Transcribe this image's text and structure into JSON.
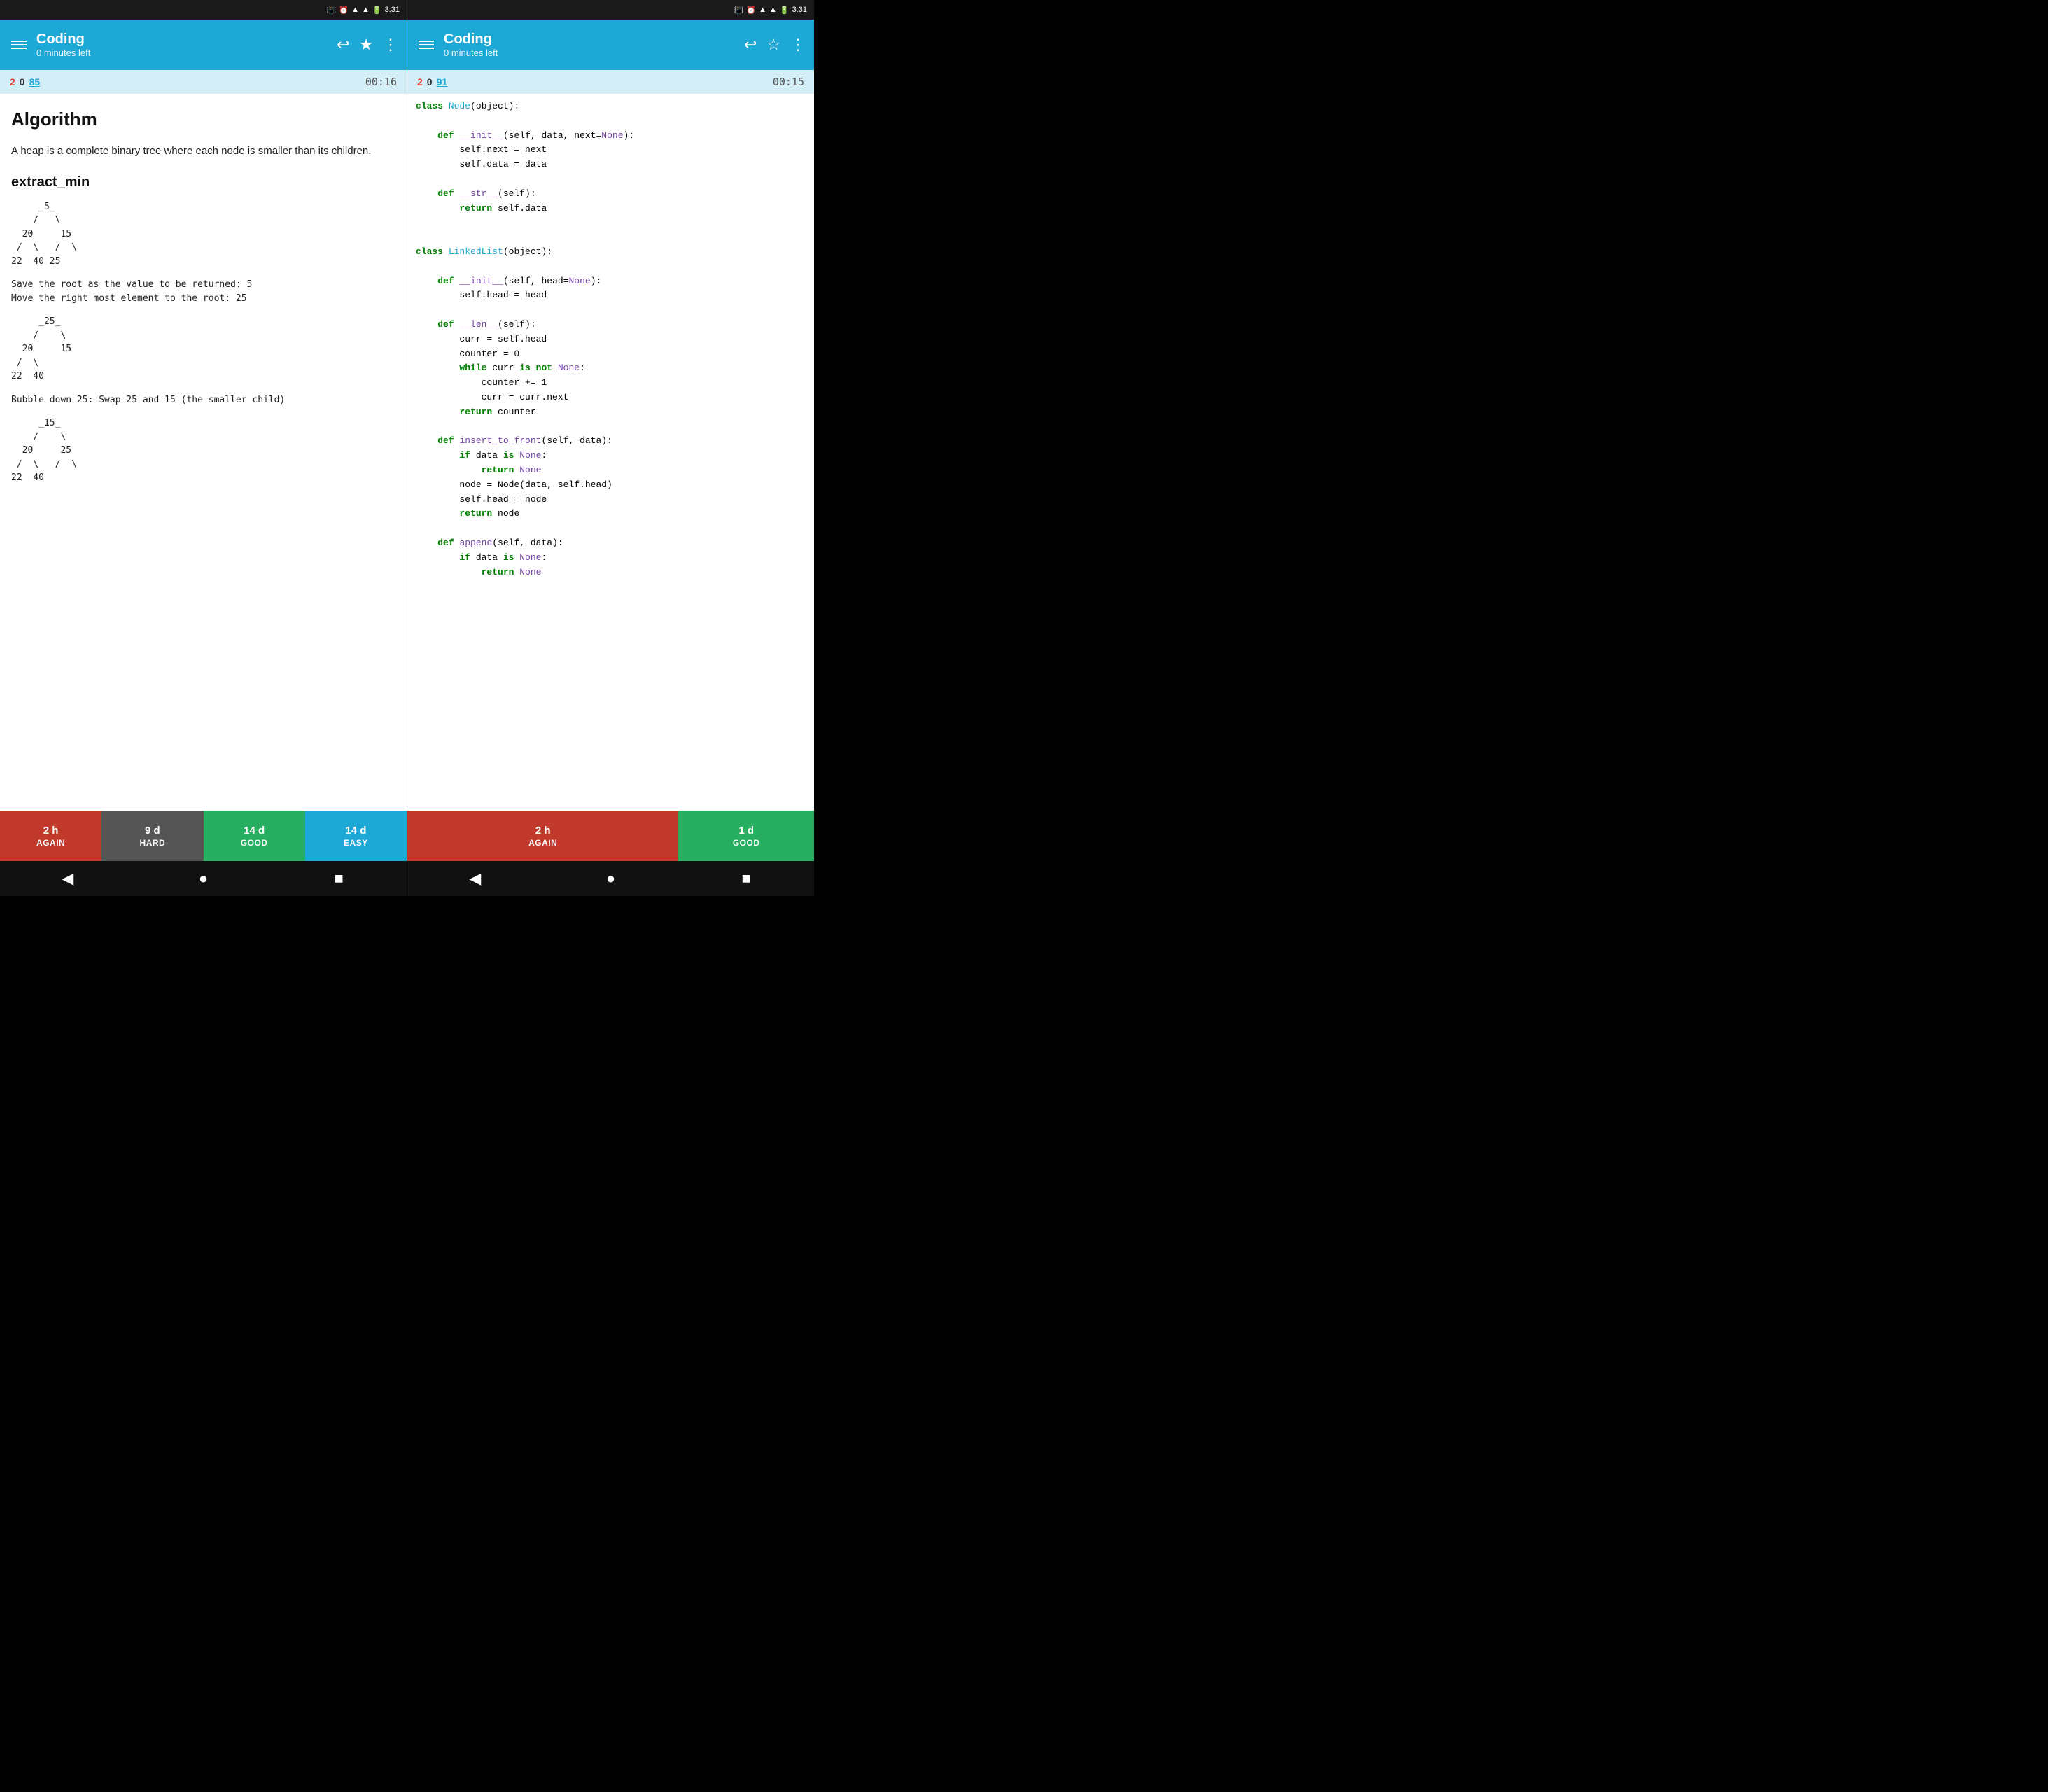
{
  "left": {
    "status_time": "3:31",
    "top_bar": {
      "title": "Coding",
      "subtitle": "0 minutes left"
    },
    "score_bar": {
      "red": "2",
      "dark": "0",
      "link": "85",
      "time": "00:16"
    },
    "content": {
      "heading": "Algorithm",
      "description": "A heap is a complete binary tree where each node is smaller than its children.",
      "subheading": "extract_min",
      "tree1": "     _5_\n    /   \\\n  20     15\n /  \\   /  \\\n22  40 25",
      "desc1": "Save the root as the value to be returned: 5\nMove the right most element to the root: 25",
      "tree2": "     _25_\n    /    \\\n  20     15\n /  \\\n22  40",
      "desc2": "Bubble down 25: Swap 25 and 15 (the smaller child)",
      "tree3": "     _15_\n    /    \\\n  20     25\n /  \\   /  \\\n22  40"
    },
    "footer": {
      "again_time": "2 h",
      "again_label": "AGAIN",
      "hard_time": "9 d",
      "hard_label": "HARD",
      "good_time": "14 d",
      "good_label": "GOOD",
      "easy_time": "14 d",
      "easy_label": "EASY"
    }
  },
  "right": {
    "status_time": "3:31",
    "top_bar": {
      "title": "Coding",
      "subtitle": "0 minutes left"
    },
    "score_bar": {
      "red": "2",
      "dark": "0",
      "link": "91",
      "time": "00:15"
    },
    "footer": {
      "again_time": "2 h",
      "again_label": "AGAIN",
      "good_time": "1 d",
      "good_label": "GOOD"
    }
  },
  "icons": {
    "menu": "☰",
    "undo": "↩",
    "star_filled": "★",
    "star_outline": "☆",
    "more": "⋮",
    "back": "◀",
    "home": "●",
    "square": "■"
  }
}
